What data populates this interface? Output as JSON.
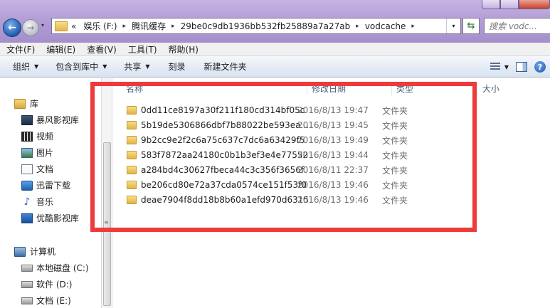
{
  "address": {
    "prefix": "«",
    "segments": [
      "娱乐 (F:)",
      "腾讯缓存",
      "29be0c9db1936bb532fb25889a7a27ab",
      "vodcache"
    ],
    "separator": "▸",
    "dropdown": "▾"
  },
  "search": {
    "placeholder": "搜索 vodc..."
  },
  "menu": [
    "文件(F)",
    "编辑(E)",
    "查看(V)",
    "工具(T)",
    "帮助(H)"
  ],
  "toolbar": {
    "organize": "组织",
    "include_library": "包含到库中",
    "share": "共享",
    "burn": "刻录",
    "new_folder": "新建文件夹",
    "caret": "▼",
    "help": "?"
  },
  "nav": {
    "libraries": "库",
    "lib_items": [
      "暴风影视库",
      "视频",
      "图片",
      "文档",
      "迅雷下载",
      "音乐",
      "优酷影视库"
    ],
    "computer": "计算机",
    "drives": [
      "本地磁盘 (C:)",
      "软件 (D:)",
      "文档 (E:)"
    ]
  },
  "columns": {
    "name": "名称",
    "date": "修改日期",
    "type": "类型",
    "size": "大小"
  },
  "files": [
    {
      "name": "0dd11ce8197a30f211f180cd314bf05c",
      "date": "2016/8/13 19:47",
      "type": "文件夹"
    },
    {
      "name": "5b19de5306866dbf7b88022be593ea...",
      "date": "2016/8/13 19:45",
      "type": "文件夹"
    },
    {
      "name": "9b2cc9e2f2c6a75c637c7dc6a63429f5",
      "date": "2016/8/13 19:49",
      "type": "文件夹"
    },
    {
      "name": "583f7872aa24180c0b1b3ef3e4e77552",
      "date": "2016/8/13 19:44",
      "type": "文件夹"
    },
    {
      "name": "a284bd4c30627fbeca44c3c356f3656f",
      "date": "2016/8/11 22:37",
      "type": "文件夹"
    },
    {
      "name": "be206cd80e72a37cda0574ce151f53f0",
      "date": "2016/8/13 19:46",
      "type": "文件夹"
    },
    {
      "name": "deae7904f8dd18b8b60a1efd970d6315",
      "date": "2016/8/13 19:46",
      "type": "文件夹"
    }
  ],
  "colors": {
    "highlight": "#ee3a3a",
    "title_bar": "#b39ed6",
    "header_text": "#4c607a"
  }
}
